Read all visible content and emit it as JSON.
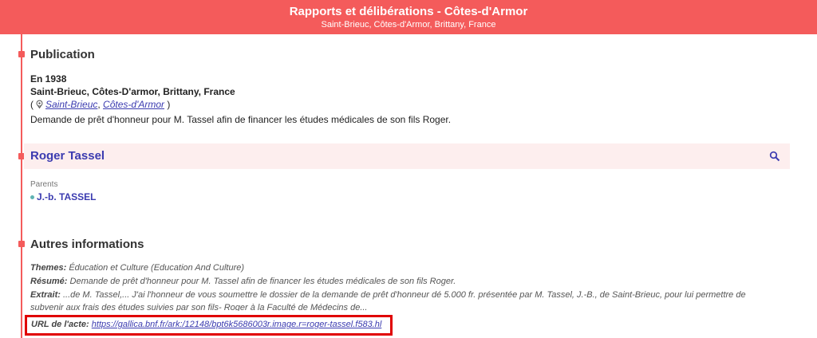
{
  "header": {
    "title": "Rapports et délibérations - Côtes-d'Armor",
    "subtitle": "Saint-Brieuc, Côtes-d'Armor, Brittany, France"
  },
  "publication": {
    "heading": "Publication",
    "year": "En 1938",
    "place": "Saint-Brieuc, Côtes-D'armor, Brittany, France",
    "location_links": [
      "Saint-Brieuc",
      "Côtes-d'Armor"
    ],
    "description": "Demande de prêt d'honneur pour M. Tassel afin de financer les études médicales de son fils Roger."
  },
  "person": {
    "name": "Roger Tassel",
    "search_icon": "search-icon",
    "parents_label": "Parents",
    "parents": [
      "J.-b. TASSEL"
    ]
  },
  "other_info": {
    "heading": "Autres informations",
    "themes_label": "Themes:",
    "themes_value": "Éducation et Culture (Education And Culture)",
    "resume_label": "Résumé:",
    "resume_value": "Demande de prêt d'honneur pour M. Tassel afin de financer les études médicales de son fils Roger.",
    "extrait_label": "Extrait:",
    "extrait_value": "...de M. Tassel,... J'ai l'honneur de vous soumettre le dossier de la demande de prêt d'honneur dé 5.000 fr. présentée par M. Tassel, J.-B., de Saint-Brieuc, pour lui permettre de subvenir aux frais des études suivies par son fils- Roger à la Faculté de Médecins de...",
    "url_label": "URL de l'acte:",
    "url_value": "https://gallica.bnf.fr/ark:/12148/bpt6k5686003r.image.r=roger-tassel.f583.hl"
  },
  "colors": {
    "accent": "#f45b5b",
    "link": "#3b3bb0",
    "highlight_box": "#e00000"
  }
}
